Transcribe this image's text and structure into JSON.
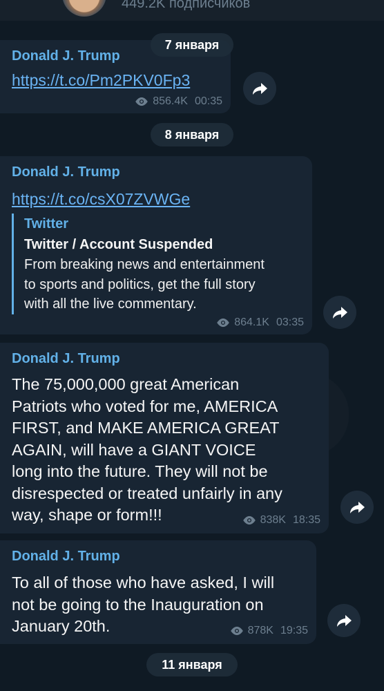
{
  "header": {
    "subscribers": "449.2K подписчиков"
  },
  "dates": [
    "7 января",
    "8 января",
    "11 января"
  ],
  "messages": [
    {
      "sender": "Donald J. Trump",
      "link": "https://t.co/Pm2PKV0Fp3",
      "views": "856.4K",
      "time": "00:35"
    },
    {
      "sender": "Donald J. Trump",
      "link": "https://t.co/csX07ZVWGe",
      "preview": {
        "site": "Twitter",
        "title": "Twitter / Account Suspended",
        "description_lines": [
          "From breaking news and entertainment",
          "to sports and politics, get the full story",
          "with all the live commentary."
        ]
      },
      "views": "864.1K",
      "time": "03:35"
    },
    {
      "sender": "Donald J. Trump",
      "lines": [
        "The 75,000,000 great American",
        "Patriots who voted for me, AMERICA",
        "FIRST, and MAKE AMERICA GREAT",
        "AGAIN, will have a GIANT VOICE",
        "long into the future. They will not be",
        "disrespected or treated unfairly in any",
        "way, shape or form!!!"
      ],
      "views": "838K",
      "time": "18:35"
    },
    {
      "sender": "Donald J. Trump",
      "lines": [
        "To all of those who have asked, I will",
        "not be going to the Inauguration on",
        "January 20th."
      ],
      "views": "878K",
      "time": "19:35"
    }
  ],
  "icons": {
    "views": "eye-icon",
    "forward": "share-arrow-icon"
  },
  "colors": {
    "background": "#0e1621",
    "bubble": "#182533",
    "accent": "#62b1e8",
    "link": "#6ab3f3",
    "meta": "#6d7f8f"
  }
}
